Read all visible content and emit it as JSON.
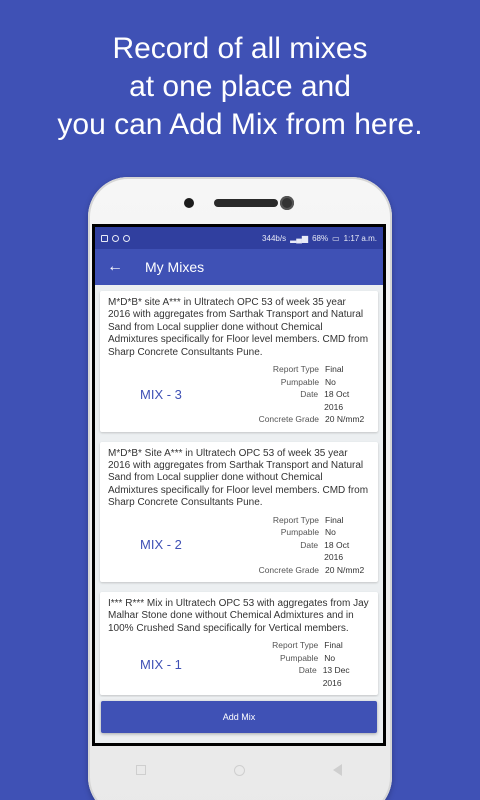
{
  "headline": [
    "Record of all mixes",
    "at one place and",
    "you can Add Mix from here."
  ],
  "statusbar": {
    "speed": "344b/s",
    "battery": "68%",
    "time": "1:17 a.m."
  },
  "appbar": {
    "title": "My Mixes",
    "back_icon": "arrow-back-icon"
  },
  "meta_labels": {
    "report_type": "Report Type",
    "pumpable": "Pumpable",
    "date": "Date",
    "grade": "Concrete Grade"
  },
  "mixes": [
    {
      "description": "M*D*B* site A*** in Ultratech OPC 53 of week 35 year 2016 with aggregates from Sarthak Transport and Natural Sand from Local supplier done without Chemical Admixtures specifically for Floor level members. CMD from Sharp Concrete Consultants Pune.",
      "label": "MIX - 3",
      "report_type": "Final",
      "pumpable": "No",
      "date": "18 Oct 2016",
      "grade": "20 N/mm2"
    },
    {
      "description": "M*D*B* Site A*** in Ultratech OPC 53 of week 35 year 2016 with aggregates from Sarthak Transport and Natural Sand from Local supplier done without Chemical Admixtures specifically for Floor level members. CMD from Sharp Concrete Consultants Pune.",
      "label": "MIX - 2",
      "report_type": "Final",
      "pumpable": "No",
      "date": "18 Oct 2016",
      "grade": "20 N/mm2"
    },
    {
      "description": "I*** R*** Mix in Ultratech OPC 53 with aggregates from Jay Malhar Stone done without Chemical Admixtures and in 100% Crushed Sand specifically for Vertical members.",
      "label": "MIX - 1",
      "report_type": "Final",
      "pumpable": "No",
      "date": "13 Dec 2016"
    }
  ],
  "add_button": "Add Mix",
  "colors": {
    "primary": "#3F51B5",
    "primary_dark": "#303F9F",
    "list_background": "#ECEFF1"
  }
}
